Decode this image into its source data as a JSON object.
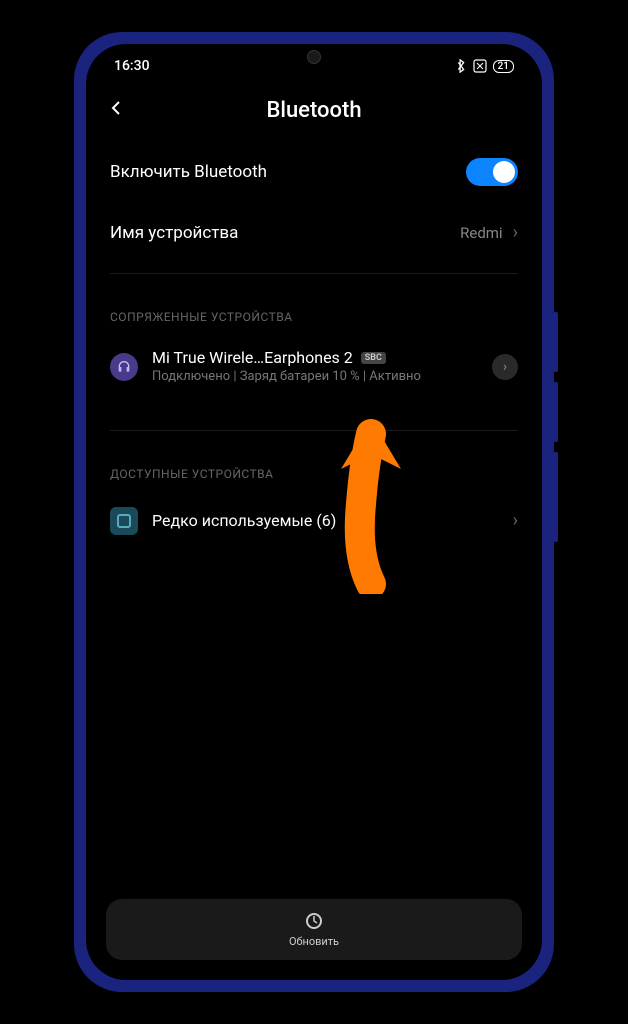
{
  "statusbar": {
    "time": "16:30",
    "battery": "21"
  },
  "header": {
    "title": "Bluetooth"
  },
  "settings": {
    "enable_label": "Включить Bluetooth",
    "device_name_label": "Имя устройства",
    "device_name_value": "Redmi"
  },
  "sections": {
    "paired_header": "СОПРЯЖЕННЫЕ УСТРОЙСТВА",
    "available_header": "ДОСТУПНЫЕ УСТРОЙСТВА"
  },
  "paired_device": {
    "name": "Mi True Wirele…Earphones 2",
    "codec": "SBC",
    "status": "Подключено | Заряд батареи 10 % | Активно"
  },
  "rare_devices": {
    "label": "Редко используемые (6)"
  },
  "bottom": {
    "refresh_label": "Обновить"
  }
}
